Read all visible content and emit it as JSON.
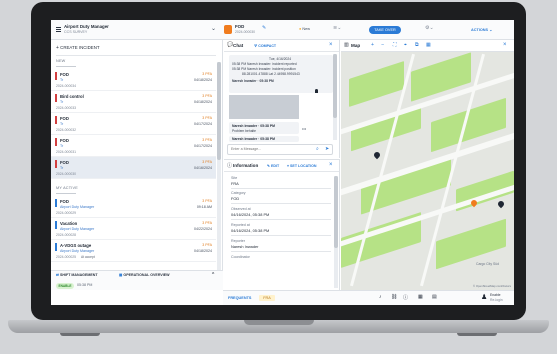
{
  "topbar": {
    "user_name": "Airport Duty Manager",
    "user_org": "CCS SURVEY",
    "incident_title": "FOD",
    "incident_id": "2024-000030",
    "status": "New",
    "take_over": "TAKE OVER",
    "actions": "ACTIONS"
  },
  "left": {
    "create_label": "CREATE INCIDENT",
    "section_new": "NEW",
    "section_active": "MY ACTIVE",
    "new_items": [
      {
        "title": "FOD",
        "sub": "Tr",
        "id": "2024-000034",
        "priority": "3 PFA",
        "date": "04/18/2024"
      },
      {
        "title": "Bird control",
        "sub": "Tr",
        "id": "2024-000033",
        "priority": "3 PFA",
        "date": "04/18/2024"
      },
      {
        "title": "FOD",
        "sub": "Tr",
        "id": "2024-000032",
        "priority": "3 PFA",
        "date": "04/17/2024"
      },
      {
        "title": "FOD",
        "sub": "Tr",
        "id": "2024-000031",
        "priority": "3 PFA",
        "date": "04/17/2024"
      },
      {
        "title": "FOD",
        "sub": "Tr",
        "id": "2024-000030",
        "priority": "3 PFA",
        "date": "04/16/2024"
      }
    ],
    "active_items": [
      {
        "title": "FOD",
        "sub": "Airport Duty Manager",
        "id": "2024-000029",
        "priority": "3 PFA",
        "date": "09:18 AM",
        "tag": ""
      },
      {
        "title": "Vacation",
        "sub": "Airport Duty Manager",
        "id": "2024-000028",
        "priority": "3 PFA",
        "date": "04/22/2024",
        "tag": ""
      },
      {
        "title": "A-VDGS outage",
        "sub": "Airport Duty Manager",
        "id": "2024-000025",
        "priority": "3 PFA",
        "date": "04/18/2024",
        "tag": "At accept"
      }
    ],
    "footer_shift": "SHIFT MANAGEMENT",
    "footer_overview": "OPERATIONAL OVERVIEW",
    "status_badge": "ENABLE",
    "status_time": "05:38 PM"
  },
  "chat": {
    "title": "Chat",
    "compact": "COMPACT",
    "msg_date": "Tue, 4/16/2024",
    "msg_line1": "05:38 PM Naresh Inwader: incident reported",
    "msg_line2": "05:38 PM Naresh Inwader: incident position",
    "msg_line3": "88.281001.47888 Lat 2.44958.9991543",
    "card1_name": "Naresh Inwader · 05:38 PM",
    "card2_name": "Naresh Inwader · 05:38 PM",
    "card2_text": "Problem behalte",
    "card3_name": "Naresh Inwader · 05:38 PM",
    "input_placeholder": "Enter a Message..."
  },
  "info": {
    "title": "Information",
    "edit": "EDIT",
    "set_location": "SET LOCATION",
    "fields": [
      {
        "label": "Site",
        "value": "FRA"
      },
      {
        "label": "Category",
        "value": "FOD"
      },
      {
        "label": "Observed at",
        "value": "04/16/2024, 05:38 PM"
      },
      {
        "label": "Reported at",
        "value": "04/16/2024, 05:38 PM"
      },
      {
        "label": "Reporter",
        "value": "Naresh Inwader"
      },
      {
        "label": "Coordinator",
        "value": ""
      }
    ]
  },
  "map": {
    "title": "Map",
    "attribution": "© OpenStreetMap contributors",
    "area_label": "Cargo City Süd"
  },
  "bottombar": {
    "frequents": "FREQUENTS",
    "fra": "FRA",
    "user_initials": "Enable",
    "user_status": "Re-login"
  }
}
